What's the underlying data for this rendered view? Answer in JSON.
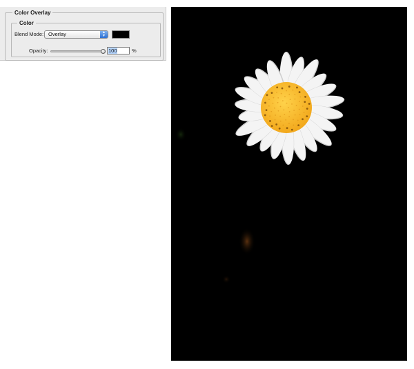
{
  "panel": {
    "section_title": "Color Overlay",
    "group_title": "Color",
    "blend_mode": {
      "label": "Blend Mode:",
      "value": "Overlay"
    },
    "color_swatch": "#000000",
    "opacity": {
      "label": "Opacity:",
      "value": "100",
      "unit": "%",
      "slider_percent": 100
    }
  },
  "canvas": {
    "background": "#000000",
    "subject": "daisy-flower-image",
    "colors": {
      "petal": "#f4f4f4",
      "petal_shadow": "#cfcfcf",
      "center": "#f2a81c",
      "center_highlight": "#ffd24a",
      "center_dots": "#7a4a08"
    }
  }
}
